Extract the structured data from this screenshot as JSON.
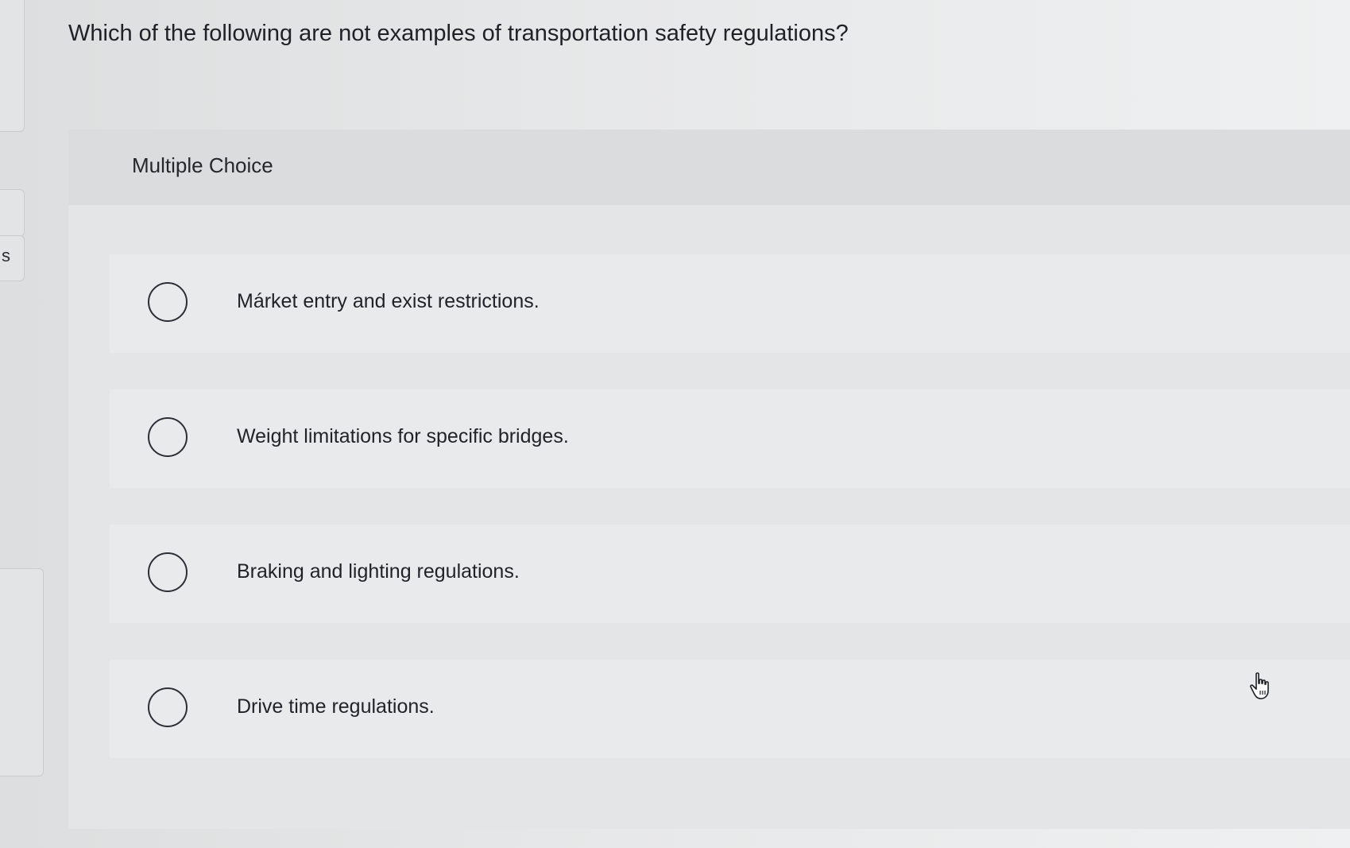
{
  "question": {
    "text": "Which of the following are not examples of transportation safety regulations?"
  },
  "sidebar": {
    "partial_label": "s"
  },
  "card": {
    "header_label": "Multiple Choice",
    "options": [
      {
        "label": "Márket entry and exist restrictions.",
        "selected": false
      },
      {
        "label": "Weight limitations for specific bridges.",
        "selected": false
      },
      {
        "label": "Braking and lighting regulations.",
        "selected": false
      },
      {
        "label": "Drive time regulations.",
        "selected": false
      }
    ]
  },
  "cursor": {
    "icon": "hand-pointer-icon"
  }
}
